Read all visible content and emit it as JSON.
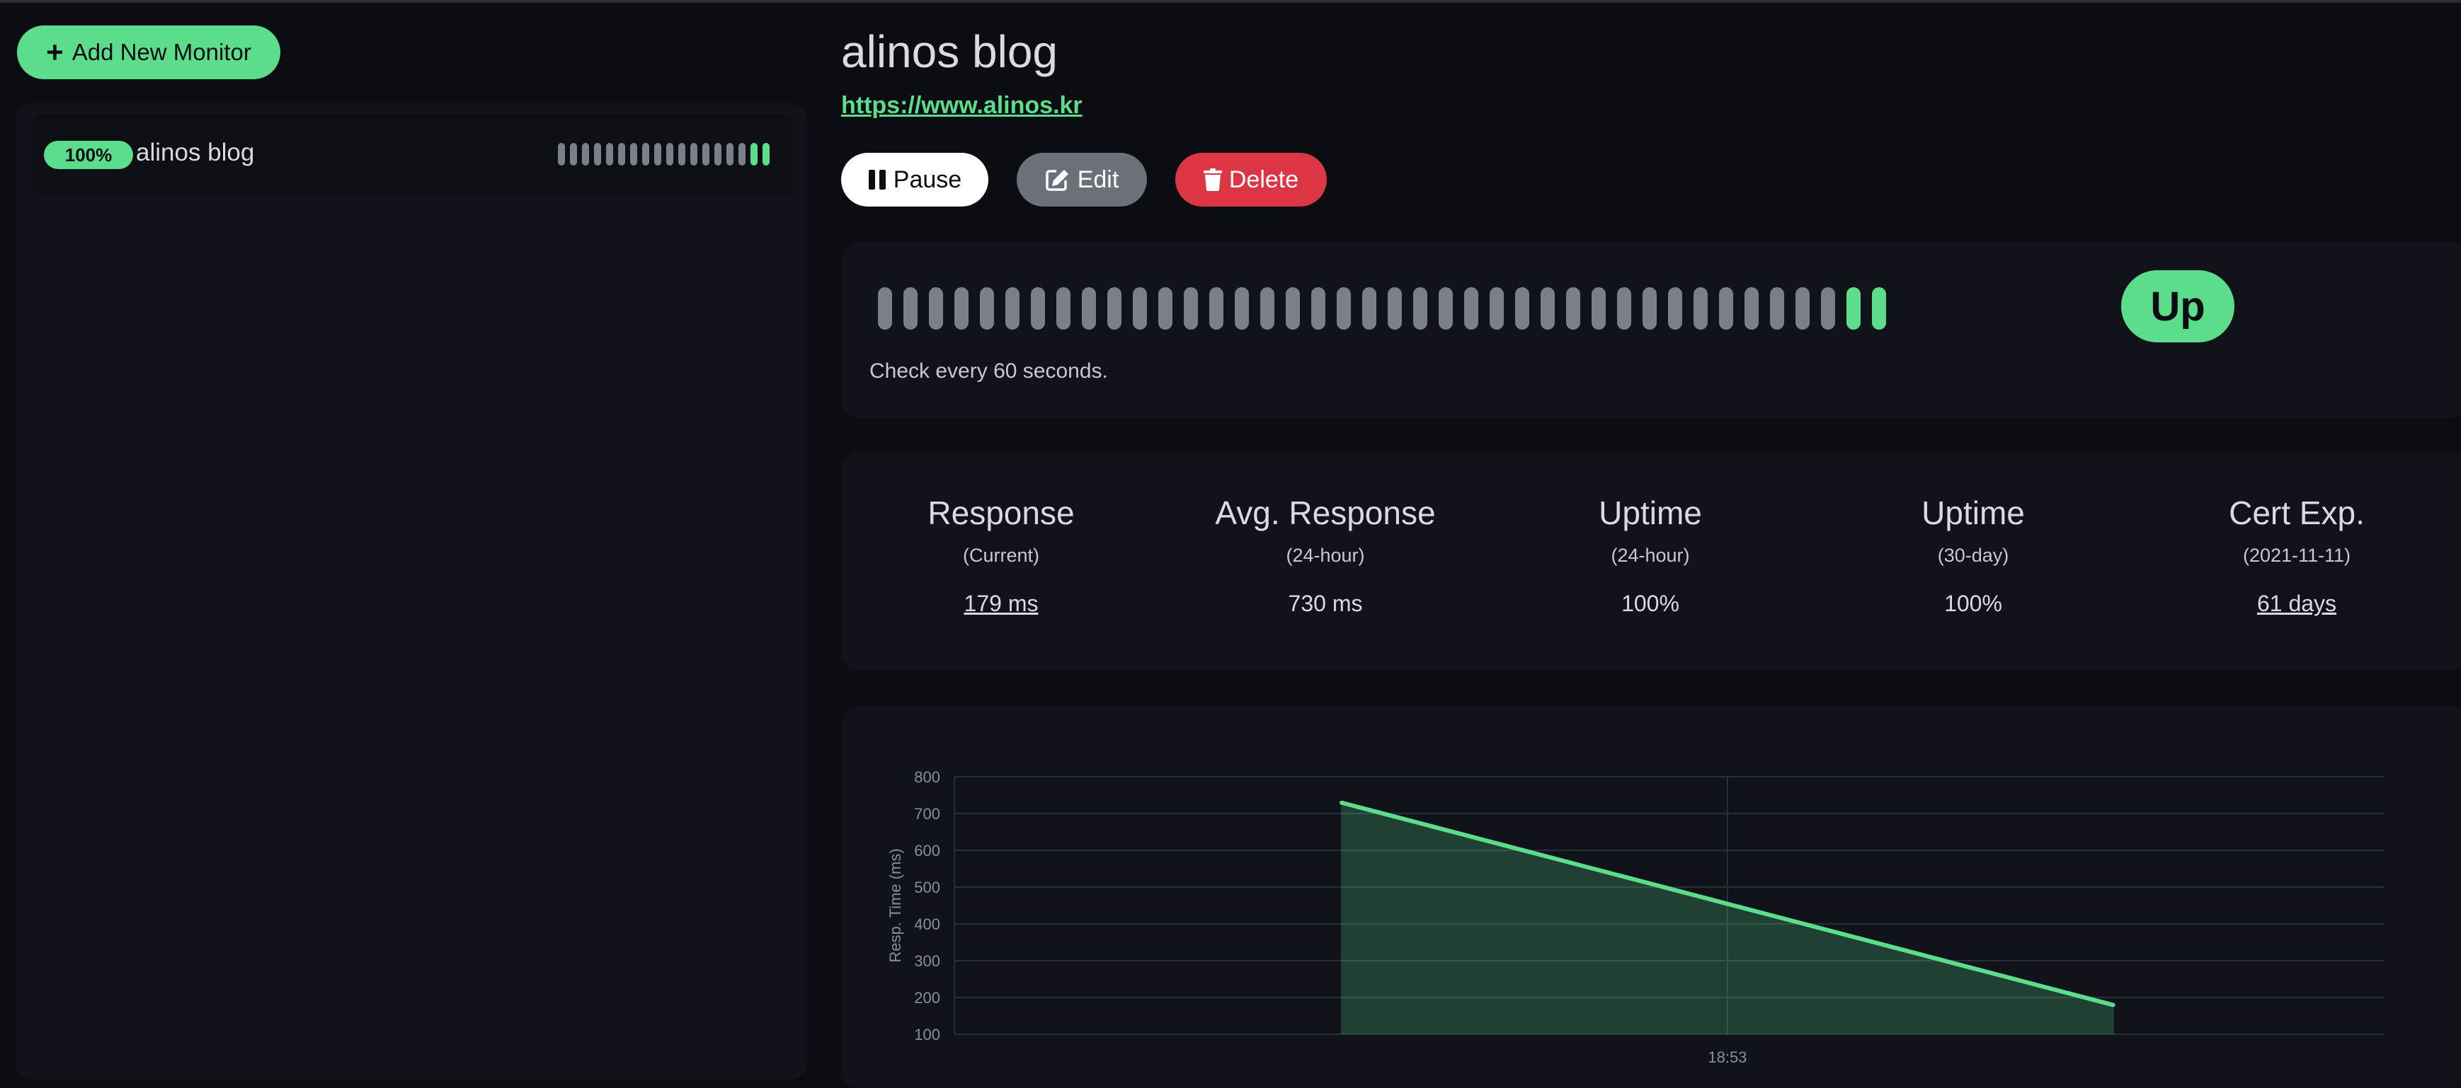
{
  "sidebar": {
    "add_button_label": "Add New Monitor",
    "monitors": [
      {
        "name": "alinos blog",
        "uptime_badge": "100%",
        "beats": [
          "down",
          "down",
          "down",
          "down",
          "down",
          "down",
          "down",
          "down",
          "down",
          "down",
          "down",
          "down",
          "down",
          "down",
          "down",
          "down",
          "up",
          "up"
        ]
      }
    ]
  },
  "monitor": {
    "title": "alinos blog",
    "url": "https://www.alinos.kr",
    "actions": {
      "pause_label": "Pause",
      "edit_label": "Edit",
      "delete_label": "Delete"
    },
    "beats": [
      "down",
      "down",
      "down",
      "down",
      "down",
      "down",
      "down",
      "down",
      "down",
      "down",
      "down",
      "down",
      "down",
      "down",
      "down",
      "down",
      "down",
      "down",
      "down",
      "down",
      "down",
      "down",
      "down",
      "down",
      "down",
      "down",
      "down",
      "down",
      "down",
      "down",
      "down",
      "down",
      "down",
      "down",
      "down",
      "down",
      "down",
      "down",
      "up",
      "up"
    ],
    "check_text": "Check every 60 seconds.",
    "status": "Up",
    "stats": [
      {
        "title": "Response",
        "sub": "(Current)",
        "value": "179 ms",
        "link": true
      },
      {
        "title": "Avg. Response",
        "sub": "(24-hour)",
        "value": "730 ms",
        "link": false
      },
      {
        "title": "Uptime",
        "sub": "(24-hour)",
        "value": "100%",
        "link": false
      },
      {
        "title": "Uptime",
        "sub": "(30-day)",
        "value": "100%",
        "link": false
      },
      {
        "title": "Cert Exp.",
        "sub": "(2021-11-11)",
        "value": "61 days",
        "link": true
      }
    ]
  },
  "colors": {
    "accent": "#5cdd8b",
    "danger": "#dc3545",
    "neutral": "#7b7f86",
    "background": "#0b0d12",
    "card": "#10141a"
  },
  "chart_data": {
    "type": "area",
    "ylabel": "Resp. Time (ms)",
    "xlabel": "",
    "y_ticks": [
      100,
      200,
      300,
      400,
      500,
      600,
      700,
      800
    ],
    "x_ticks": [
      {
        "label": "18:53",
        "x": 0.5
      }
    ],
    "x_range": [
      -0.5,
      1.35
    ],
    "ylim": [
      100,
      800
    ],
    "grid": true,
    "series": [
      {
        "x": [
          0,
          1
        ],
        "values": [
          730,
          179
        ]
      }
    ]
  }
}
